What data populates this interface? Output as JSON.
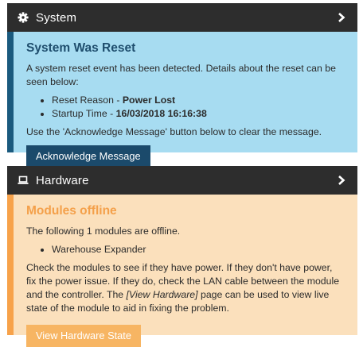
{
  "system": {
    "header_title": "System",
    "header_icon": "gear-icon",
    "chevron_icon": "chevron-right-icon",
    "body_bg": "#a7dcf1",
    "stripe_color": "#1a5a7e",
    "title_color": "#1f4e6e",
    "title": "System Was Reset",
    "intro": "A system reset event has been detected. Details about the reset can be seen below:",
    "items": [
      {
        "label": "Reset Reason - ",
        "value": "Power Lost"
      },
      {
        "label": "Startup Time - ",
        "value": "16/03/2018 16:16:38"
      }
    ],
    "outro": "Use the 'Acknowledge Message' button below to clear the message.",
    "button_label": "Acknowledge Message",
    "button_color": "#1b4a6b"
  },
  "hardware": {
    "header_title": "Hardware",
    "header_icon": "laptop-icon",
    "chevron_icon": "chevron-right-icon",
    "body_bg": "#fbe0bc",
    "stripe_color": "#f7a24a",
    "title_color": "#f4a04a",
    "title": "Modules offline",
    "intro": "The following 1 modules are offline.",
    "items": [
      "Warehouse Expander"
    ],
    "text_part1": "Check the modules to see if they have power. If they don't have power, fix the power issue. If they do, check the LAN cable between the module and the controller. The ",
    "text_link": "[View Hardware]",
    "text_part2": " page can be used to view live state of the module to aid in fixing the problem.",
    "button_label": "View Hardware State",
    "button_color": "#f7b563"
  }
}
